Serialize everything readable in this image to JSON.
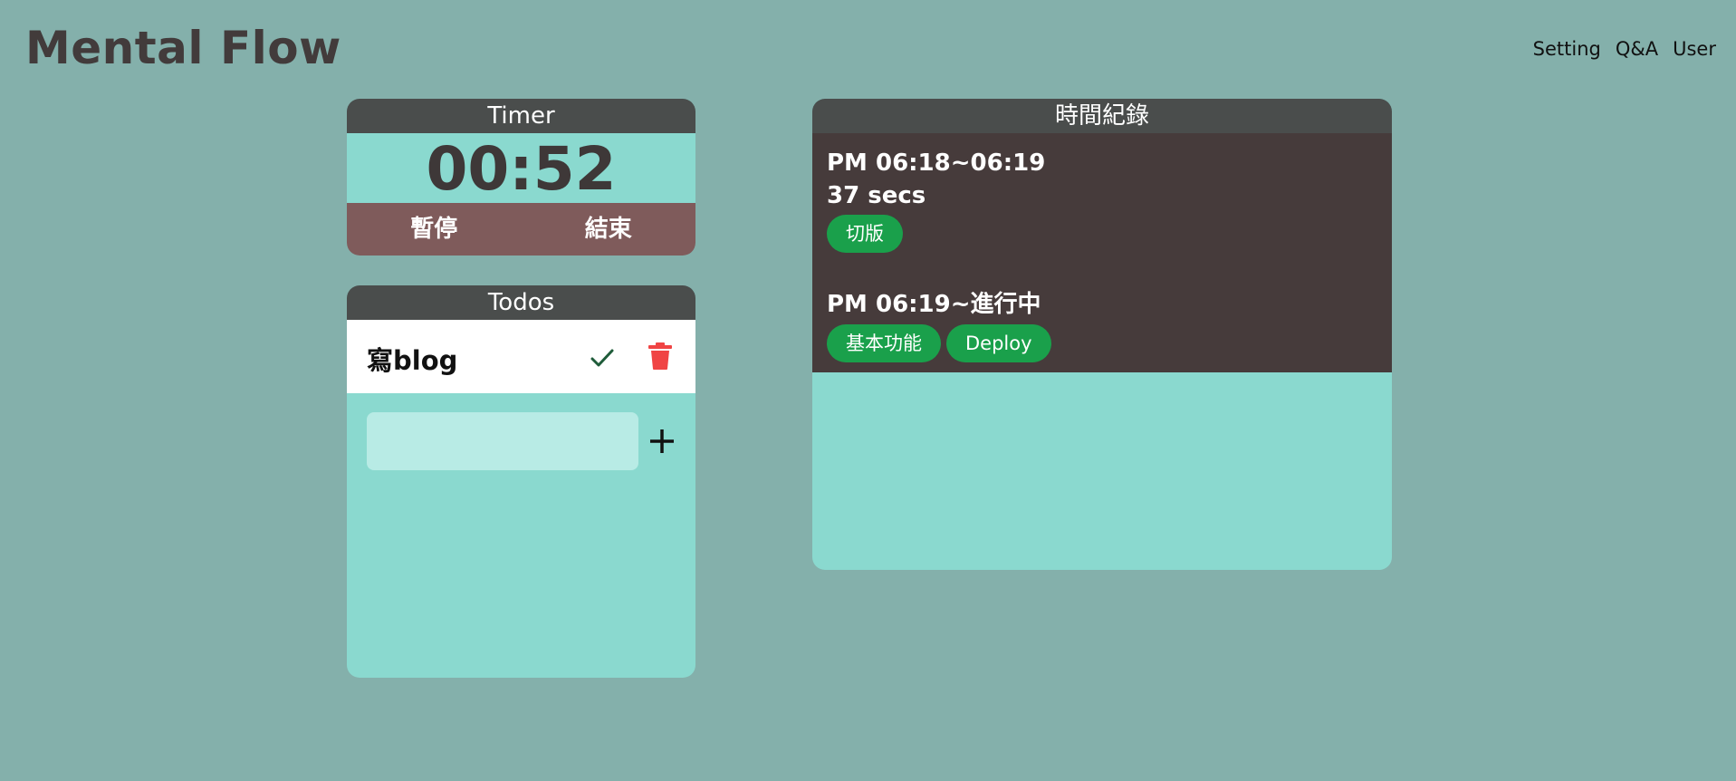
{
  "app": {
    "title": "Mental Flow"
  },
  "nav": [
    {
      "label": "Setting"
    },
    {
      "label": "Q&A"
    },
    {
      "label": "User"
    }
  ],
  "timer": {
    "title": "Timer",
    "display": "00:52",
    "pause_label": "暫停",
    "end_label": "結束"
  },
  "todos": {
    "title": "Todos",
    "items": [
      {
        "text": "寫blog"
      }
    ],
    "input_value": ""
  },
  "records": {
    "title": "時間紀錄",
    "entries": [
      {
        "time": "PM 06:18~06:19",
        "duration": "37 secs",
        "tags": [
          "切版"
        ]
      },
      {
        "time": "PM 06:19~進行中",
        "duration": "",
        "tags": [
          "基本功能",
          "Deploy"
        ]
      }
    ]
  },
  "colors": {
    "background": "#84b0ab",
    "card": "#8ad9cf",
    "header": "#4a4d4c",
    "timer_actions": "#7f5b5b",
    "records_body": "#463b3b",
    "tag": "#1aa04b",
    "check": "#1f5c3a",
    "trash": "#f04444"
  },
  "icons": {
    "done": "check-icon",
    "delete": "trash-icon",
    "add": "plus-icon"
  }
}
